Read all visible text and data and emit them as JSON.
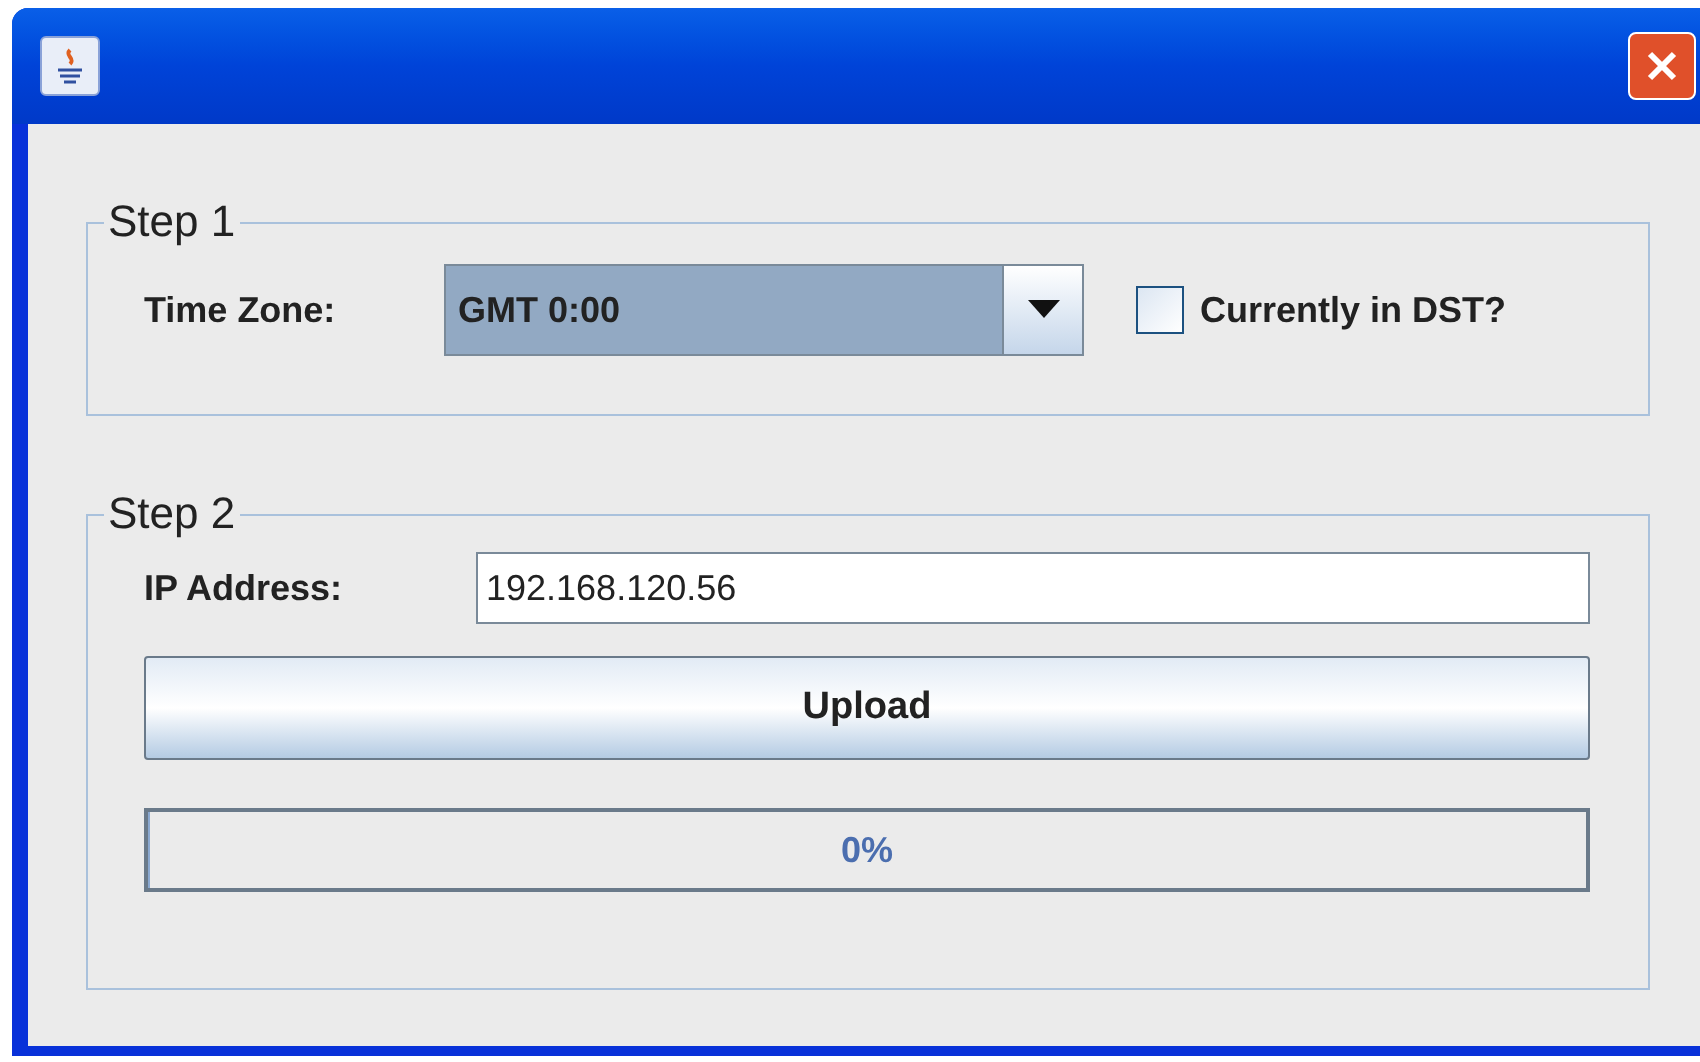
{
  "step1": {
    "title": "Step 1",
    "time_zone_label": "Time Zone:",
    "time_zone_value": "GMT 0:00",
    "dst": {
      "label": "Currently in DST?",
      "checked": false
    }
  },
  "step2": {
    "title": "Step 2",
    "ip_label": "IP Address:",
    "ip_value": "192.168.120.56",
    "upload_button": "Upload",
    "progress": {
      "level": 0,
      "reading": "0%"
    }
  }
}
